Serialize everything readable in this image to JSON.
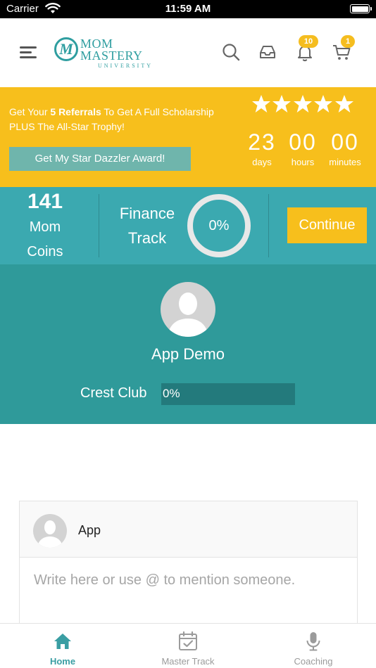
{
  "status_bar": {
    "carrier": "Carrier",
    "time": "11:59 AM"
  },
  "header": {
    "logo_line1": "MOM",
    "logo_line2": "MASTERY",
    "logo_line3": "UNIVERSITY",
    "logo_mark": "M",
    "notifications_badge": "10",
    "cart_badge": "1",
    "icons": [
      "menu-icon",
      "search-icon",
      "inbox-icon",
      "bell-icon",
      "cart-icon"
    ]
  },
  "promo": {
    "text_prefix": "Get Your ",
    "text_bold": "5 Referrals",
    "text_suffix": " To Get A Full Scholarship PLUS The All-Star Trophy!",
    "award_button": "Get My Star Dazzler Award!",
    "stars": 5,
    "countdown": [
      {
        "value": "23",
        "label": "days"
      },
      {
        "value": "00",
        "label": "hours"
      },
      {
        "value": "00",
        "label": "minutes"
      }
    ]
  },
  "stats": {
    "coins_value": "141",
    "coins_label_1": "Mom",
    "coins_label_2": "Coins",
    "track_label_1": "Finance",
    "track_label_2": "Track",
    "track_progress": "0%",
    "continue_button": "Continue"
  },
  "profile": {
    "name": "App Demo",
    "crest_label": "Crest Club",
    "crest_progress": "0%"
  },
  "composer": {
    "user_name": "App",
    "placeholder": "Write here or use @ to mention someone."
  },
  "tabbar": {
    "tabs": [
      {
        "label": "Home",
        "icon": "home-icon",
        "active": true
      },
      {
        "label": "Master Track",
        "icon": "calendar-check-icon",
        "active": false
      },
      {
        "label": "Coaching",
        "icon": "microphone-icon",
        "active": false
      }
    ]
  },
  "colors": {
    "brand_teal": "#2f9ea0",
    "promo_yellow": "#f7bf1c",
    "stats_teal": "#3ba9b0",
    "profile_teal": "#2f9a9a",
    "award_button": "#6fb5ac"
  }
}
